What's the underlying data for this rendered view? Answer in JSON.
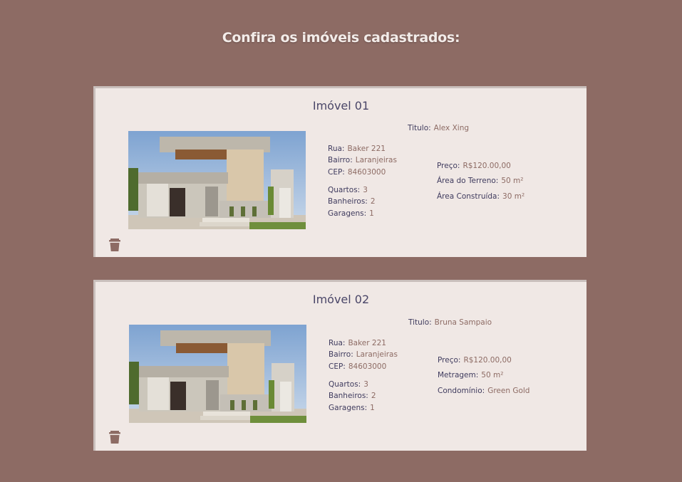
{
  "page": {
    "title": "Confira os imóveis cadastrados:"
  },
  "colors": {
    "background": "#8d6b64",
    "card": "#f0e8e5",
    "label": "#3f3b5e",
    "value": "#8d6b64"
  },
  "properties": [
    {
      "title": "Imóvel 01",
      "titulo_label": "Titulo:",
      "titulo_value": "Alex Xing",
      "rua_label": "Rua:",
      "rua_value": "Baker  221",
      "bairro_label": "Bairro:",
      "bairro_value": "Laranjeiras",
      "cep_label": "CEP:",
      "cep_value": "84603000",
      "quartos_label": "Quartos:",
      "quartos_value": "3",
      "banheiros_label": "Banheiros:",
      "banheiros_value": "2",
      "garagens_label": "Garagens:",
      "garagens_value": "1",
      "preco_label": "Preço:",
      "preco_value": "R$120.00,00",
      "extra1_label": "Área do Terreno:",
      "extra1_value": "50 m²",
      "extra2_label": "Área Construída:",
      "extra2_value": "30 m²",
      "delete_icon": "trash-icon"
    },
    {
      "title": "Imóvel 02",
      "titulo_label": "Titulo:",
      "titulo_value": "Bruna Sampaio",
      "rua_label": "Rua:",
      "rua_value": "Baker  221",
      "bairro_label": "Bairro:",
      "bairro_value": "Laranjeiras",
      "cep_label": "CEP:",
      "cep_value": "84603000",
      "quartos_label": "Quartos:",
      "quartos_value": "3",
      "banheiros_label": "Banheiros:",
      "banheiros_value": "2",
      "garagens_label": "Garagens:",
      "garagens_value": "1",
      "preco_label": "Preço:",
      "preco_value": "R$120.00,00",
      "extra1_label": "Metragem:",
      "extra1_value": "50 m²",
      "extra2_label": "Condomínio:",
      "extra2_value": "Green Gold",
      "delete_icon": "trash-icon"
    }
  ]
}
